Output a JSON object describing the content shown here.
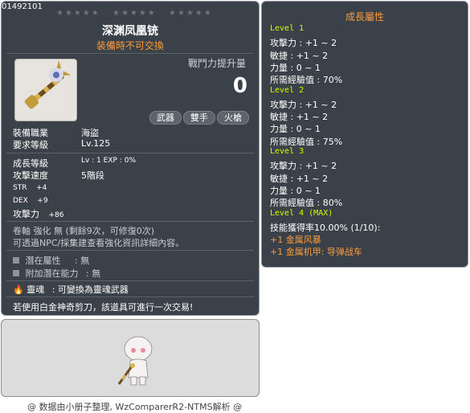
{
  "item": {
    "id": "01492101",
    "name": "深渊凤凰铳",
    "trade": "装備時不可交換",
    "combat_power_label": "戰鬥力提升量",
    "combat_power_value": "0",
    "tags": [
      "武器",
      "雙手",
      "火槍"
    ]
  },
  "info": {
    "job_label": "裝備職業",
    "job_value": "海盜",
    "level_label": "要求等級",
    "level_value": "Lv.125",
    "growth_label": "成長等級",
    "growth_value": "Lv : 1   EXP : 0%",
    "speed_label": "攻擊速度",
    "speed_value": "5階段",
    "str_label": "STR",
    "str_value": "+4",
    "dex_label": "DEX",
    "dex_value": "+9",
    "atk_label": "攻擊力",
    "atk_value": "+86",
    "scroll_text": "卷軸 強化 無 (剩餘9次，可修復0次)",
    "npc_text": "可透過NPC/採集建查看強化資訊詳細內容。",
    "potential_label": "潛在屬性",
    "potential_value": ": 無",
    "addpot_label": "附加潛在能力",
    "addpot_value": ": 無",
    "soul_label": "靈魂",
    "soul_value": ": 可變換為靈魂武器",
    "karma_text": "若使用白金神奇剪刀，該道具可進行一次交易!"
  },
  "growth": {
    "title": "成長屬性",
    "lines": [
      {
        "text": "Level 1",
        "kind": "level"
      },
      {
        "text": "攻擊力 : +1 ~ 2",
        "kind": "stat"
      },
      {
        "text": "敏捷 : +1 ~ 2",
        "kind": "stat"
      },
      {
        "text": "力量 : 0 ~ 1",
        "kind": "stat"
      },
      {
        "text": "所需經驗值 : 70%",
        "kind": "stat"
      },
      {
        "text": "Level 2",
        "kind": "level"
      },
      {
        "text": "攻擊力 : +1 ~ 2",
        "kind": "stat"
      },
      {
        "text": "敏捷 : +1 ~ 2",
        "kind": "stat"
      },
      {
        "text": "力量 : 0 ~ 1",
        "kind": "stat"
      },
      {
        "text": "所需經驗值 : 75%",
        "kind": "stat"
      },
      {
        "text": "Level 3",
        "kind": "level"
      },
      {
        "text": "攻擊力 : +1 ~ 2",
        "kind": "stat"
      },
      {
        "text": "敏捷 : +1 ~ 2",
        "kind": "stat"
      },
      {
        "text": "力量 : 0 ~ 1",
        "kind": "stat"
      },
      {
        "text": "所需經驗值 : 80%",
        "kind": "stat"
      },
      {
        "text": "Level 4 (MAX)",
        "kind": "level"
      },
      {
        "text": "技能獲得率10.00% (1/10):",
        "kind": "stat"
      },
      {
        "text": "+1 金属风暴",
        "kind": "orange"
      },
      {
        "text": "+1 金属机甲: 导弹战车",
        "kind": "orange"
      }
    ]
  },
  "footer": "@ 数据由小册子整理, WzComparerR2-NTMS解析 @",
  "colors": {
    "panel": "#3a4148",
    "accent_orange": "#ff9a3c",
    "level_green": "#ccff00"
  }
}
